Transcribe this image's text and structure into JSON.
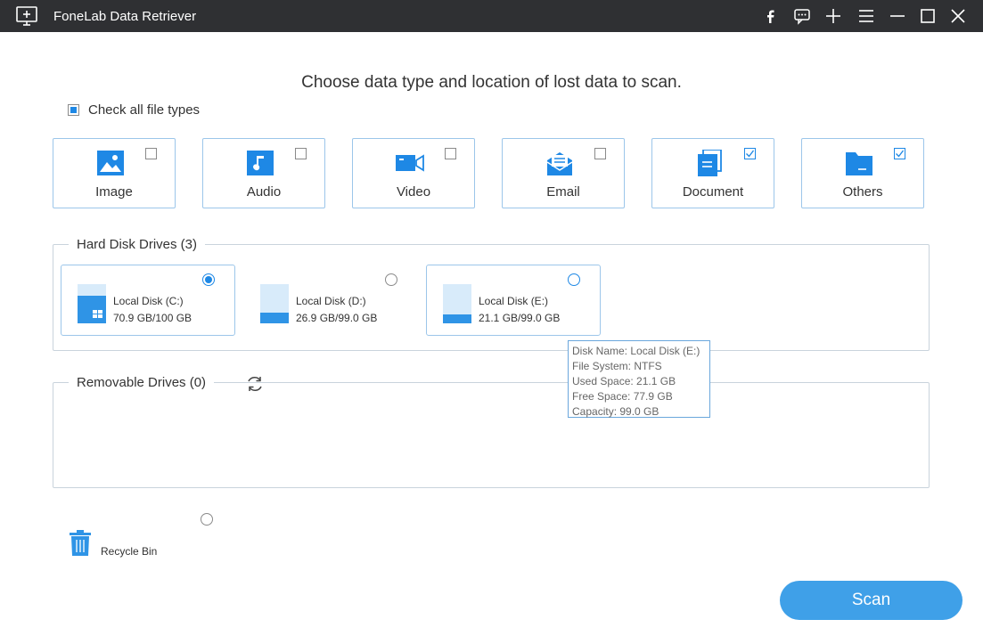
{
  "window": {
    "title": "FoneLab Data Retriever",
    "controls": [
      "facebook-icon",
      "feedback-icon",
      "plus-icon",
      "menu-icon",
      "minimize-icon",
      "maximize-icon",
      "close-icon"
    ]
  },
  "heading": "Choose data type and location of lost data to scan.",
  "check_all": {
    "label": "Check all file types",
    "state": "partial"
  },
  "file_types": [
    {
      "label": "Image",
      "icon": "image-icon",
      "checked": false
    },
    {
      "label": "Audio",
      "icon": "audio-icon",
      "checked": false
    },
    {
      "label": "Video",
      "icon": "video-icon",
      "checked": false
    },
    {
      "label": "Email",
      "icon": "email-icon",
      "checked": false
    },
    {
      "label": "Document",
      "icon": "document-icon",
      "checked": true
    },
    {
      "label": "Others",
      "icon": "others-icon",
      "checked": true
    }
  ],
  "hard_disk": {
    "title": "Hard Disk Drives (3)",
    "drives": [
      {
        "name": "Local Disk (C:)",
        "size": "70.9 GB/100 GB",
        "selected": true,
        "used_fraction": 0.71
      },
      {
        "name": "Local Disk (D:)",
        "size": "26.9 GB/99.0 GB",
        "selected": false,
        "used_fraction": 0.27
      },
      {
        "name": "Local Disk (E:)",
        "size": "21.1 GB/99.0 GB",
        "selected": false,
        "used_fraction": 0.21
      }
    ]
  },
  "tooltip": {
    "lines": [
      "Disk Name: Local Disk (E:)",
      "File System: NTFS",
      "Used Space: 21.1 GB",
      "Free Space: 77.9 GB",
      "Capacity: 99.0 GB"
    ]
  },
  "removable": {
    "title": "Removable Drives (0)"
  },
  "recycle_bin": {
    "label": "Recycle Bin",
    "selected": false
  },
  "scan_button": "Scan",
  "colors": {
    "accent": "#1e88e5",
    "titlebar": "#2f3033",
    "scan": "#3fa0e8",
    "card_border": "#9cc6ea"
  }
}
